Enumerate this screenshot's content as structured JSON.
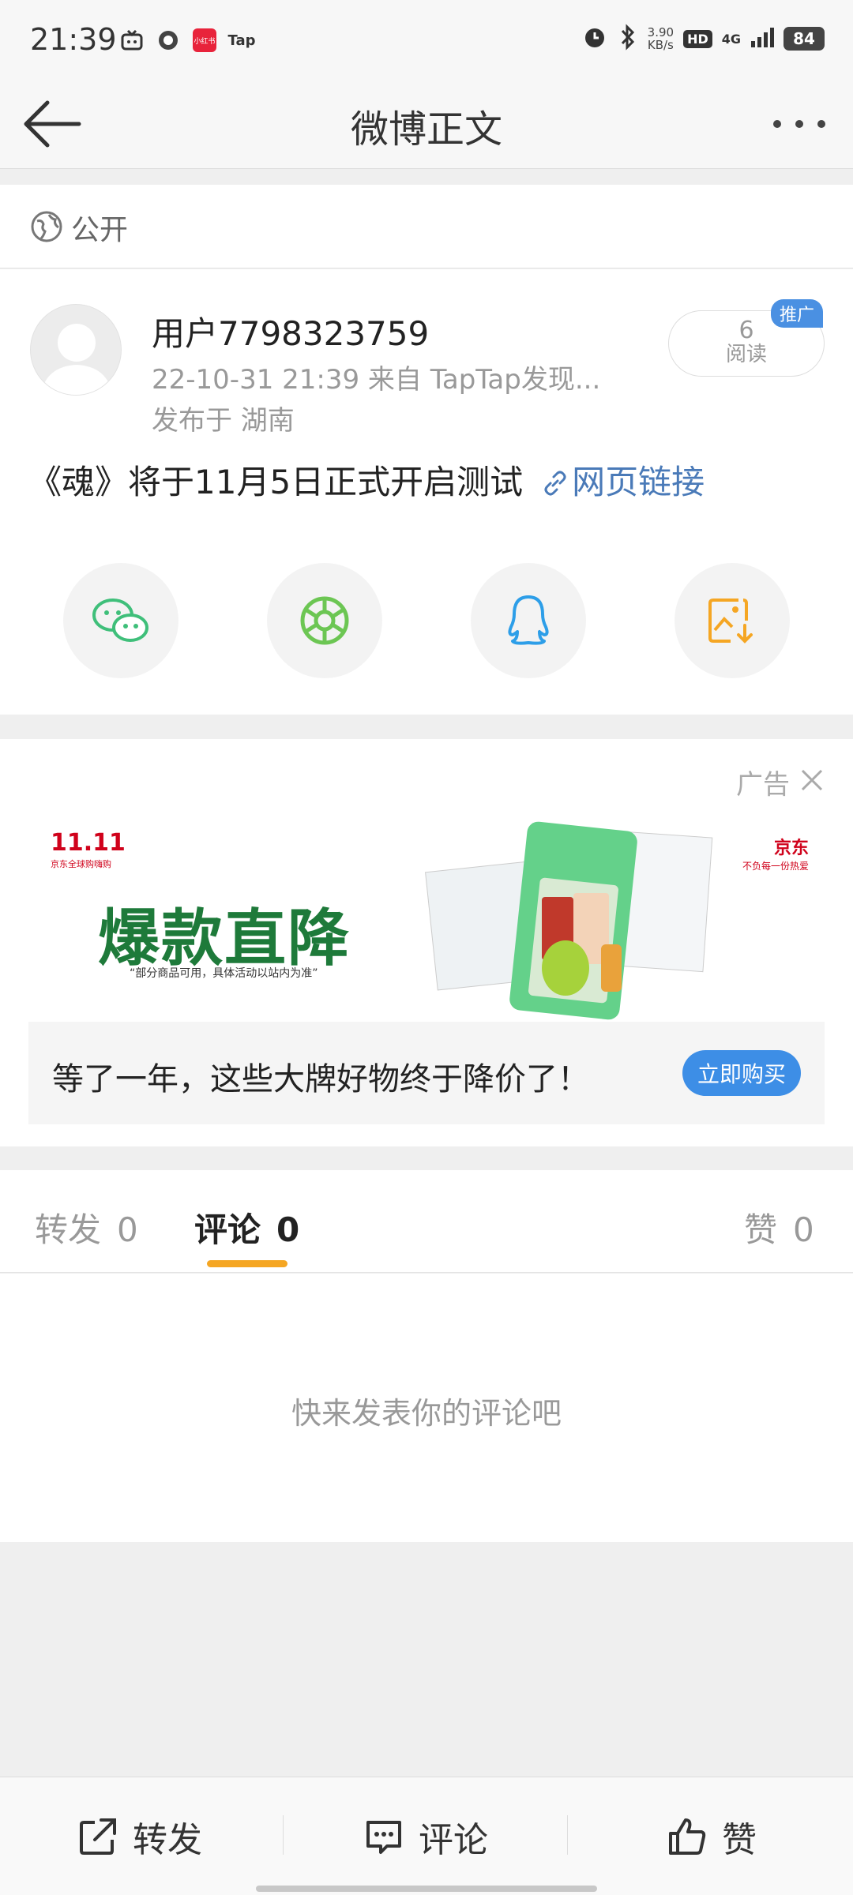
{
  "status_bar": {
    "time": "21:39",
    "app_icons": [
      "tv-app-icon",
      "headset-app-icon",
      "xiaohongshu-app-icon",
      "taptap-app-icon"
    ],
    "xiaohongshu_label": "小红书",
    "tap_label": "Tap",
    "net_speed": "3.90",
    "net_unit": "KB/s",
    "hd_label": "HD",
    "signal_label": "4G",
    "battery": "84"
  },
  "nav": {
    "title": "微博正文"
  },
  "visibility": {
    "label": "公开"
  },
  "post": {
    "username": "用户7798323759",
    "meta_line": "22-10-31  21:39   来自  TapTap发现...",
    "location_line": "发布于  湖南",
    "read_count": "6",
    "read_label": "阅读",
    "promo_tag": "推广",
    "text": "《魂》将于11月5日正式开启测试",
    "link_label": "网页链接",
    "share": [
      "wechat-icon",
      "moments-icon",
      "qq-icon",
      "save-image-icon"
    ]
  },
  "ad": {
    "label": "广告",
    "banner_tag": "11.11",
    "banner_tag_sub": "京东全球购嗨购",
    "headline": "爆款直降",
    "footnote": "“部分商品可用，具体活动以站内为准”",
    "brand": "京东",
    "brand_sub": "不负每一份热爱",
    "copy": "等了一年，这些大牌好物终于降价了！",
    "button": "立即购买"
  },
  "tabs": [
    {
      "label": "转发",
      "count": "0"
    },
    {
      "label": "评论",
      "count": "0"
    },
    {
      "label": "赞",
      "count": "0"
    }
  ],
  "empty_text": "快来发表你的评论吧",
  "bottom_bar": {
    "repost": "转发",
    "comment": "评论",
    "like": "赞"
  },
  "colors": {
    "accent_orange": "#f5a623",
    "link_blue": "#4a7ab8",
    "ad_button_blue": "#3d8ee6",
    "promo_tag_blue": "#4a90e2"
  }
}
